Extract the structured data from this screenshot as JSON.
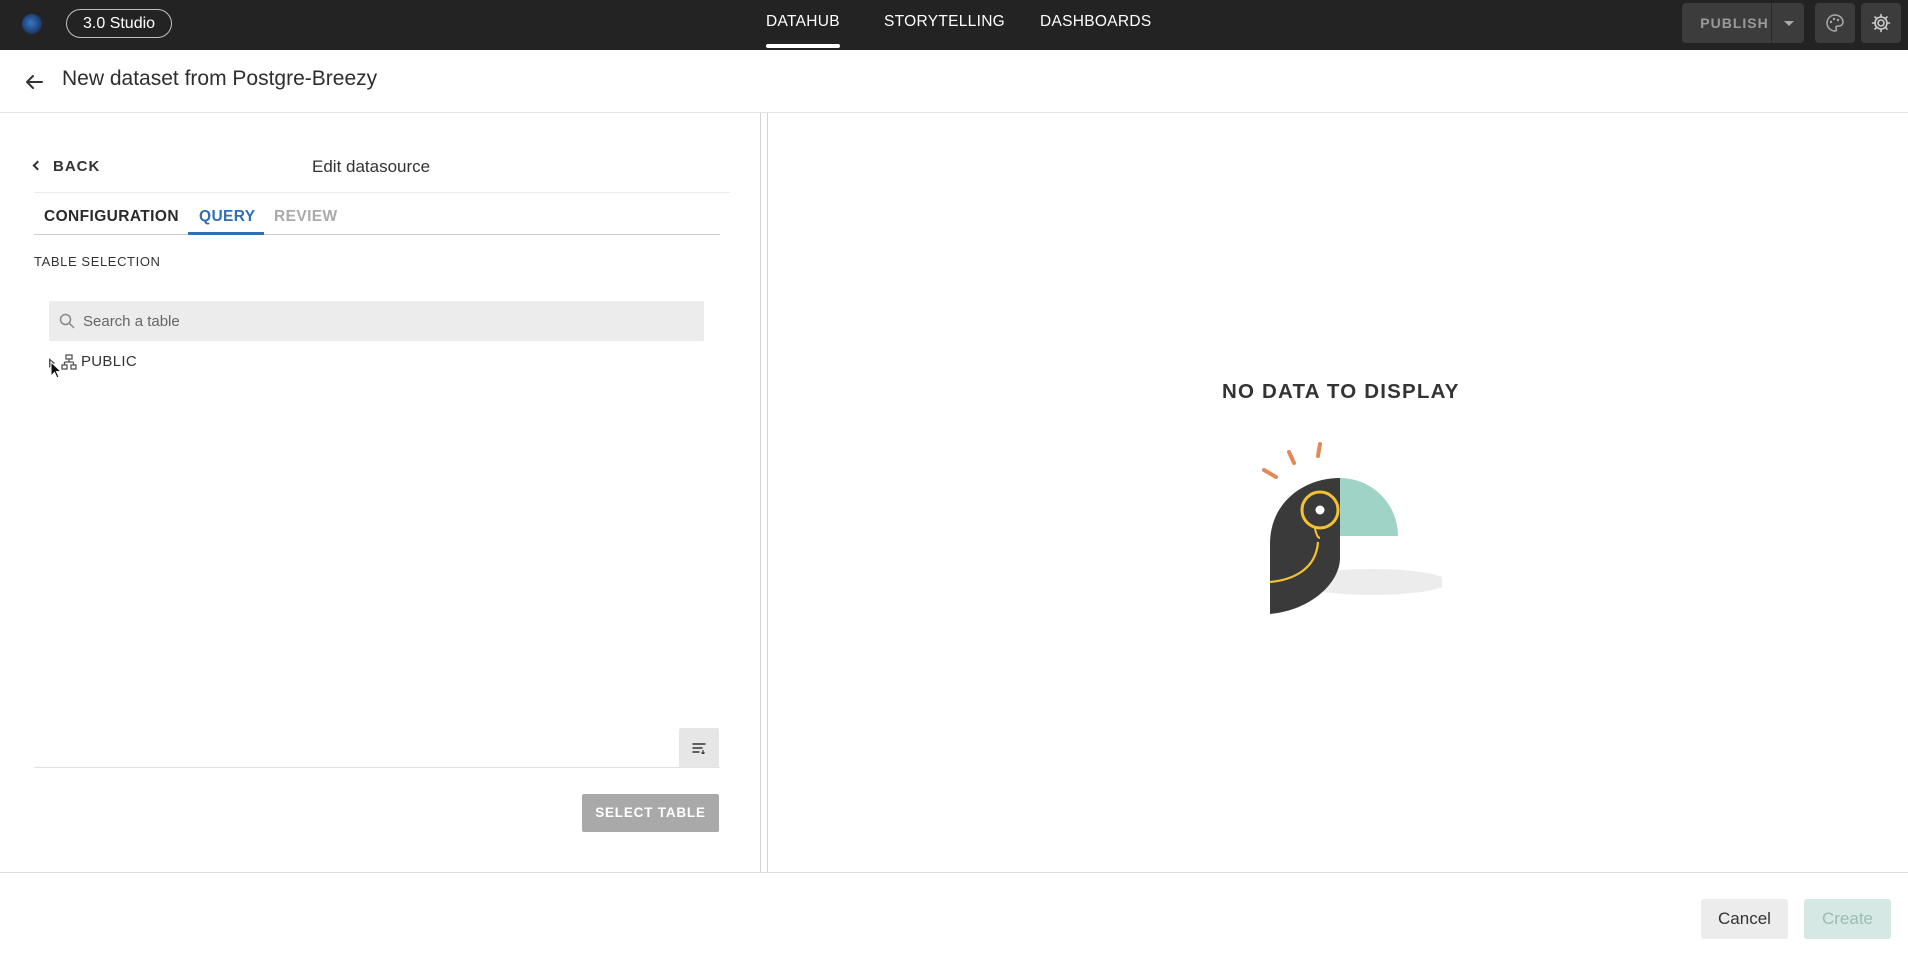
{
  "topbar": {
    "studio_label": "3.0 Studio",
    "nav": [
      {
        "label": "DATAHUB",
        "active": true
      },
      {
        "label": "STORYTELLING",
        "active": false
      },
      {
        "label": "DASHBOARDS",
        "active": false
      }
    ],
    "publish_label": "PUBLISH",
    "icons": [
      "palette-icon",
      "gear-icon"
    ]
  },
  "header": {
    "title": "New dataset from Postgre-Breezy"
  },
  "panel": {
    "back_label": "BACK",
    "title": "Edit datasource",
    "tabs": [
      {
        "label": "CONFIGURATION",
        "state": "done"
      },
      {
        "label": "QUERY",
        "state": "active"
      },
      {
        "label": "REVIEW",
        "state": "disabled"
      }
    ],
    "section_label": "TABLE SELECTION",
    "search_placeholder": "Search a table",
    "tree": [
      {
        "label": "PUBLIC",
        "icon": "schema-icon",
        "expanded": false
      }
    ],
    "select_table_label": "SELECT TABLE"
  },
  "preview": {
    "empty_message": "NO DATA TO DISPLAY"
  },
  "footer": {
    "cancel_label": "Cancel",
    "create_label": "Create"
  },
  "colors": {
    "topbar_bg": "#232323",
    "accent_blue": "#2f6fb3",
    "illustration_teal": "#9ed3c6",
    "illustration_orange": "#e08a5b",
    "illustration_yellow": "#f2c230"
  }
}
